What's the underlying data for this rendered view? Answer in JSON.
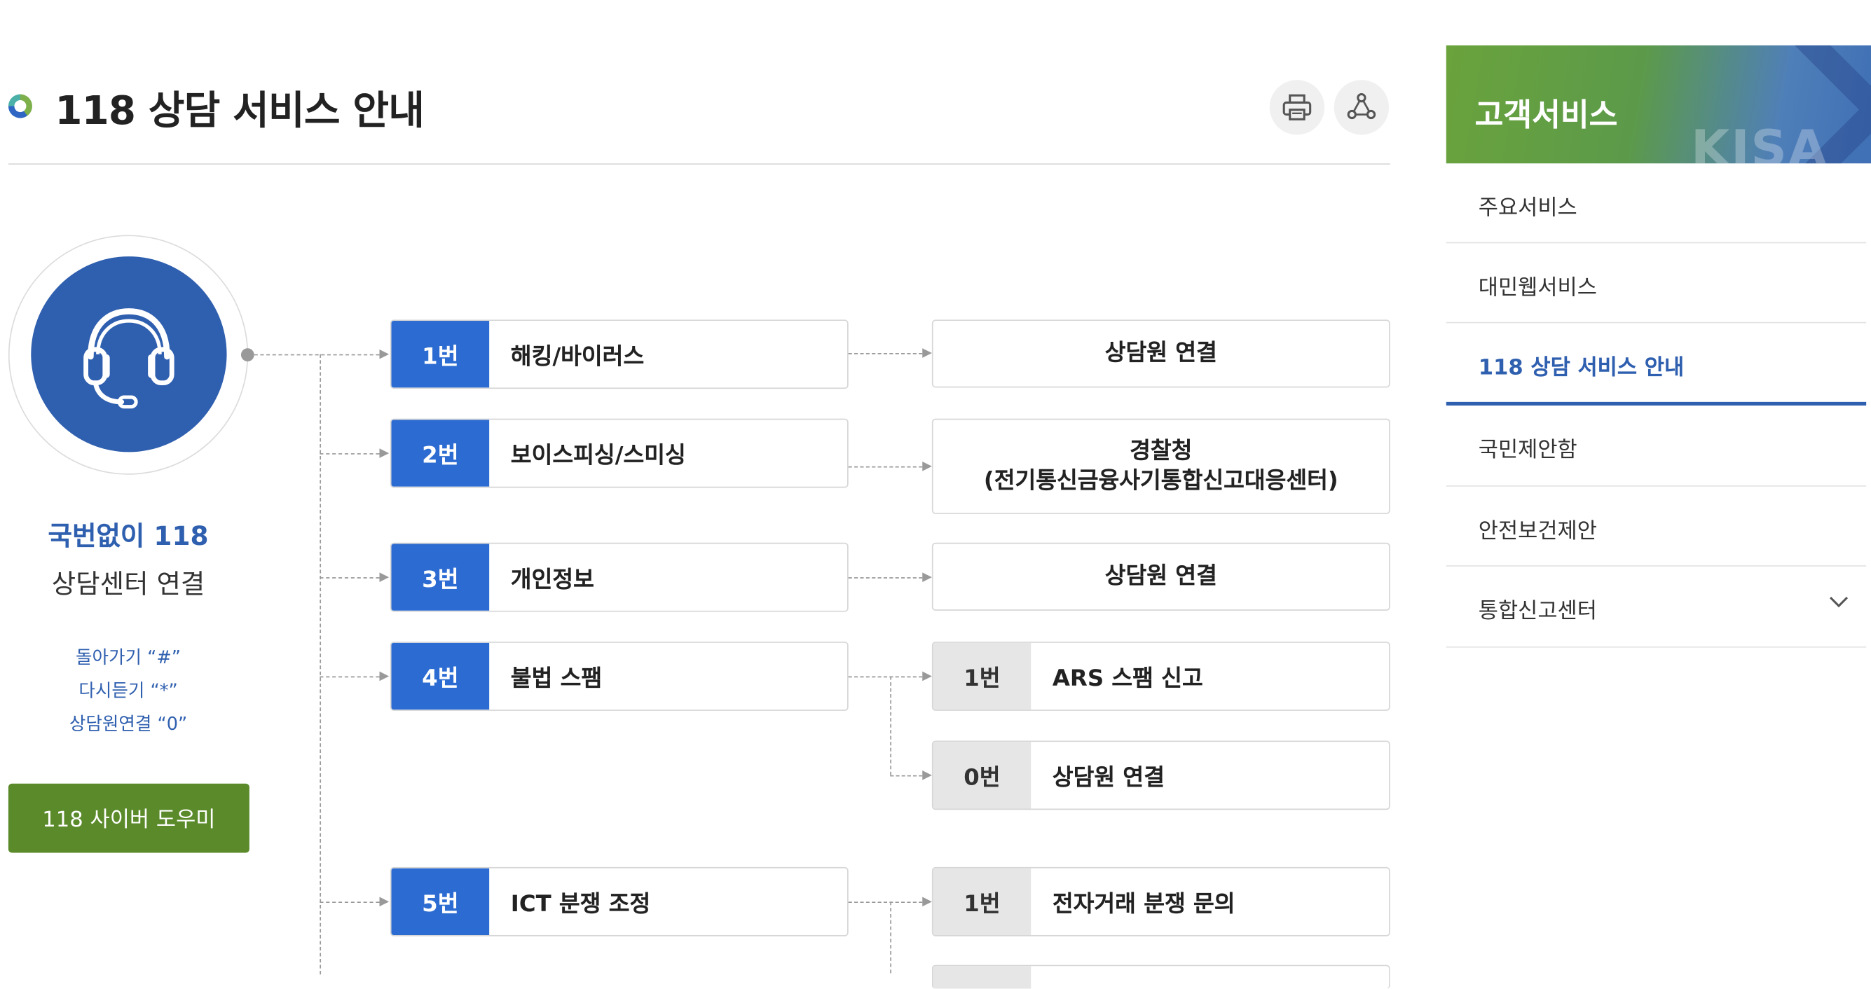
{
  "header": {
    "title": "118 상담 서비스 안내",
    "print_icon": "print-icon",
    "share_icon": "share-icon"
  },
  "badge": {
    "icon": "headset-icon",
    "line1": "국번없이 118",
    "line2": "상담센터 연결",
    "hints": [
      "돌아가기 “#”",
      "다시듣기 “*”",
      "상담원연결 “0”"
    ],
    "cyber_button": "118 사이버 도우미"
  },
  "flow": {
    "menus": [
      {
        "num": "1번",
        "label": "해킹/바이러스"
      },
      {
        "num": "2번",
        "label": "보이스피싱/스미싱"
      },
      {
        "num": "3번",
        "label": "개인정보"
      },
      {
        "num": "4번",
        "label": "불법 스팸"
      },
      {
        "num": "5번",
        "label": "ICT 분쟁 조정"
      }
    ],
    "results": {
      "r1": "상담원 연결",
      "r2_line1": "경찰청",
      "r2_line2": "(전기통신금융사기통합신고대응센터)",
      "r3": "상담원 연결"
    },
    "sub4": [
      {
        "num": "1번",
        "label": "ARS 스팸 신고"
      },
      {
        "num": "0번",
        "label": "상담원 연결"
      }
    ],
    "sub5": [
      {
        "num": "1번",
        "label": "전자거래 분쟁 문의"
      }
    ]
  },
  "sidebar": {
    "title": "고객서비스",
    "logo_text": "KISA",
    "items": [
      {
        "label": "주요서비스"
      },
      {
        "label": "대민웹서비스"
      },
      {
        "label": "118 상담 서비스 안내",
        "active": true
      },
      {
        "label": "국민제안함"
      },
      {
        "label": "안전보건제안"
      },
      {
        "label": "통합신고센터",
        "icon": "chevron-down-icon"
      }
    ]
  },
  "colors": {
    "primary_blue": "#2c6bd1",
    "badge_blue": "#2f5faf",
    "green_button": "#5a8a2a"
  }
}
